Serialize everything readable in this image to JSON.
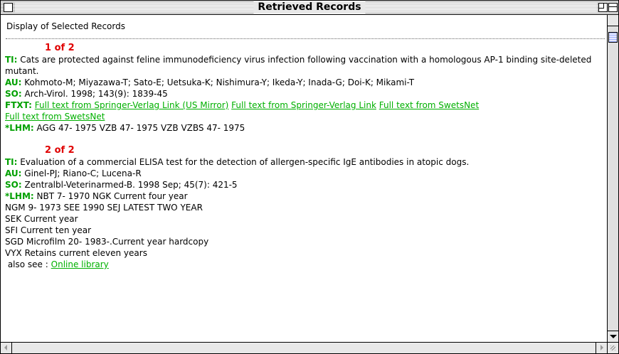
{
  "window": {
    "title": "Retrieved Records"
  },
  "heading": "Display of Selected Records",
  "labels": {
    "ti": "TI:",
    "au": "AU:",
    "so": "SO:",
    "ftxt": "FTXT:",
    "lhm": "*LHM:"
  },
  "records": [
    {
      "num": "1 of 2",
      "ti": "Cats are protected against feline immunodeficiency virus infection following vaccination with a homologous AP-1 binding site-deleted mutant.",
      "au": "Kohmoto-M; Miyazawa-T; Sato-E; Uetsuka-K; Nishimura-Y; Ikeda-Y; Inada-G; Doi-K; Mikami-T",
      "so": "Arch-Virol. 1998; 143(9): 1839-45",
      "ftxt_links": [
        "Full text from Springer-Verlag Link (US Mirror)",
        "Full text from Springer-Verlag Link",
        "Full text from SwetsNet",
        "Full text from SwetsNet"
      ],
      "lhm": "AGG 47- 1975 VZB 47- 1975 VZB VZBS  47- 1975"
    },
    {
      "num": "2 of 2",
      "ti": "Evaluation of a commercial ELISA test for the detection of allergen-specific IgE antibodies in atopic dogs.",
      "au": "Ginel-PJ; Riano-C; Lucena-R",
      "so": "Zentralbl-Veterinarmed-B. 1998 Sep; 45(7): 421-5",
      "lhm": "NBT 7- 1970 NGK Current four year",
      "holdings": [
        "NGM 9- 1973 SEE 1990 SEJ LATEST TWO YEAR",
        "SEK Current year",
        "SFI Current ten year",
        "SGD Microfilm 20- 1983-.Current year hardcopy",
        "VYX Retains current eleven years"
      ],
      "also_see_label": "also see :",
      "also_see_link": "Online library"
    }
  ],
  "colors": {
    "field_label": "#00a000",
    "link": "#00b000",
    "record_number": "#e00000"
  }
}
